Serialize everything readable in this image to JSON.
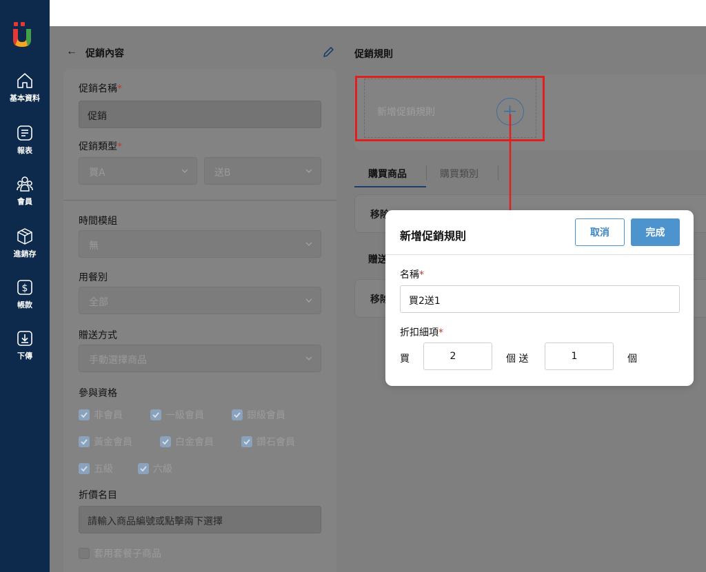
{
  "sidebar": {
    "items": [
      {
        "label": "基本資料",
        "icon": "home-icon"
      },
      {
        "label": "報表",
        "icon": "report-icon"
      },
      {
        "label": "會員",
        "icon": "members-icon"
      },
      {
        "label": "進銷存",
        "icon": "inventory-box-icon"
      },
      {
        "label": "帳款",
        "icon": "dollar-icon"
      },
      {
        "label": "下傳",
        "icon": "download-icon"
      }
    ]
  },
  "left_panel": {
    "title": "促銷內容",
    "promo_name_label": "促銷名稱",
    "promo_name_value": "促銷",
    "promo_type_label": "促銷類型",
    "promo_type_buy": "買A",
    "promo_type_give": "送B",
    "time_module_label": "時間模組",
    "time_module_value": "無",
    "meal_type_label": "用餐別",
    "meal_type_value": "全部",
    "gift_method_label": "贈送方式",
    "gift_method_value": "手動選擇商品",
    "eligibility_label": "參與資格",
    "eligibility": [
      "非會員",
      "一級會員",
      "銀級會員",
      "黃金會員",
      "白金會員",
      "鑽石會員",
      "五級",
      "六級"
    ],
    "discount_item_label": "折價名目",
    "discount_item_placeholder": "請輸入商品編號或點擊兩下選擇",
    "combo_label": "套用套餐子商品"
  },
  "right_panel": {
    "title": "促銷規則",
    "add_rule_text": "新增促銷規則",
    "tabs": [
      "購買商品",
      "購買類別"
    ],
    "row1_text": "移除",
    "sub_tab": "贈送",
    "row2_text": "移除"
  },
  "modal": {
    "title": "新增促銷規則",
    "cancel": "取消",
    "done": "完成",
    "name_label": "名稱",
    "name_value": "買2送1",
    "discount_detail_label": "折扣細項",
    "buy_label": "買",
    "buy_qty": "2",
    "give_label": "個 送",
    "give_qty": "1",
    "unit_label": "個"
  },
  "colors": {
    "sidebar": "#0d2a4c",
    "overlay": "#7f7f7f",
    "accent": "#4d94cf",
    "highlight": "#e0201f"
  }
}
